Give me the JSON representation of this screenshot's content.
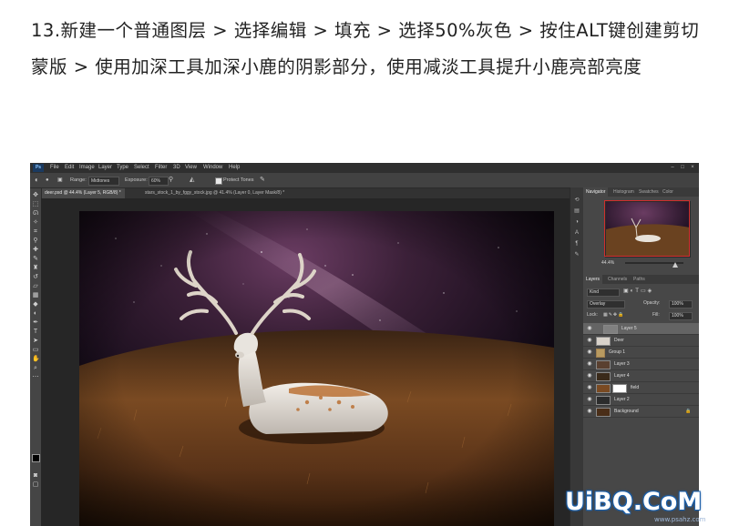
{
  "tutorial": {
    "text": "13.新建一个普通图层 > 选择编辑 > 填充 > 选择50%灰色 > 按住ALT键创建剪切蒙版 > 使用加深工具加深小鹿的阴影部分，使用减淡工具提升小鹿亮部亮度"
  },
  "photoshop": {
    "app_logo": "Ps",
    "menu": [
      "File",
      "Edit",
      "Image",
      "Layer",
      "Type",
      "Select",
      "Filter",
      "3D",
      "View",
      "Window",
      "Help"
    ],
    "window_controls": [
      "–",
      "□",
      "×"
    ],
    "options": {
      "range_label": "Range:",
      "range_value": "Midtones",
      "exposure_label": "Exposure:",
      "exposure_value": "60%",
      "protect_tones_label": "Protect Tones"
    },
    "doc_tabs": [
      {
        "label": "deer.psd @ 44.4% (Layer 5, RGB/8) *",
        "active": true
      },
      {
        "label": "stars_stock_1_by_fggy_stock.jpg @ 41.4% (Layer 0, Layer Mask/8) *",
        "active": false
      }
    ],
    "tools": [
      "move-icon",
      "marquee-icon",
      "lasso-icon",
      "quick-select-icon",
      "crop-icon",
      "eyedropper-icon",
      "heal-icon",
      "brush-icon",
      "stamp-icon",
      "history-brush-icon",
      "eraser-icon",
      "gradient-icon",
      "blur-icon",
      "dodge-icon",
      "pen-icon",
      "type-icon",
      "path-select-icon",
      "shape-icon",
      "hand-icon",
      "zoom-icon",
      "more-icon"
    ],
    "swatch_colors": {
      "foreground": "#000000",
      "background": "#ffffff"
    },
    "navigator": {
      "tabs": [
        "Navigator",
        "Histogram",
        "Swatches",
        "Color"
      ],
      "zoom": "44.4%"
    },
    "layers": {
      "tabs": [
        "Layers",
        "Channels",
        "Paths"
      ],
      "kind_label": "Kind",
      "blend_mode": "Overlay",
      "opacity_label": "Opacity:",
      "opacity_value": "100%",
      "lock_label": "Lock:",
      "fill_label": "Fill:",
      "fill_value": "100%",
      "rows": [
        {
          "name": "Layer 5",
          "selected": true
        },
        {
          "name": "Deer",
          "selected": false
        },
        {
          "name": "Group 1",
          "selected": false
        },
        {
          "name": "Layer 3",
          "selected": false
        },
        {
          "name": "Layer 4",
          "selected": false
        },
        {
          "name": "field",
          "selected": false
        },
        {
          "name": "Layer 2",
          "selected": false
        },
        {
          "name": "Background",
          "selected": false
        }
      ]
    }
  },
  "watermark": {
    "logo": "UiBQ.CoM",
    "site": "www.psahz.com"
  },
  "colors": {
    "sky_top": "#140c1c",
    "sky_glow": "#5a3050",
    "grass_dark": "#2a1608",
    "grass_light": "#8a5a2c",
    "deer_body": "#e6e2dc",
    "deer_spots": "#b86a2a",
    "brand_blue": "#1c5fa8"
  }
}
